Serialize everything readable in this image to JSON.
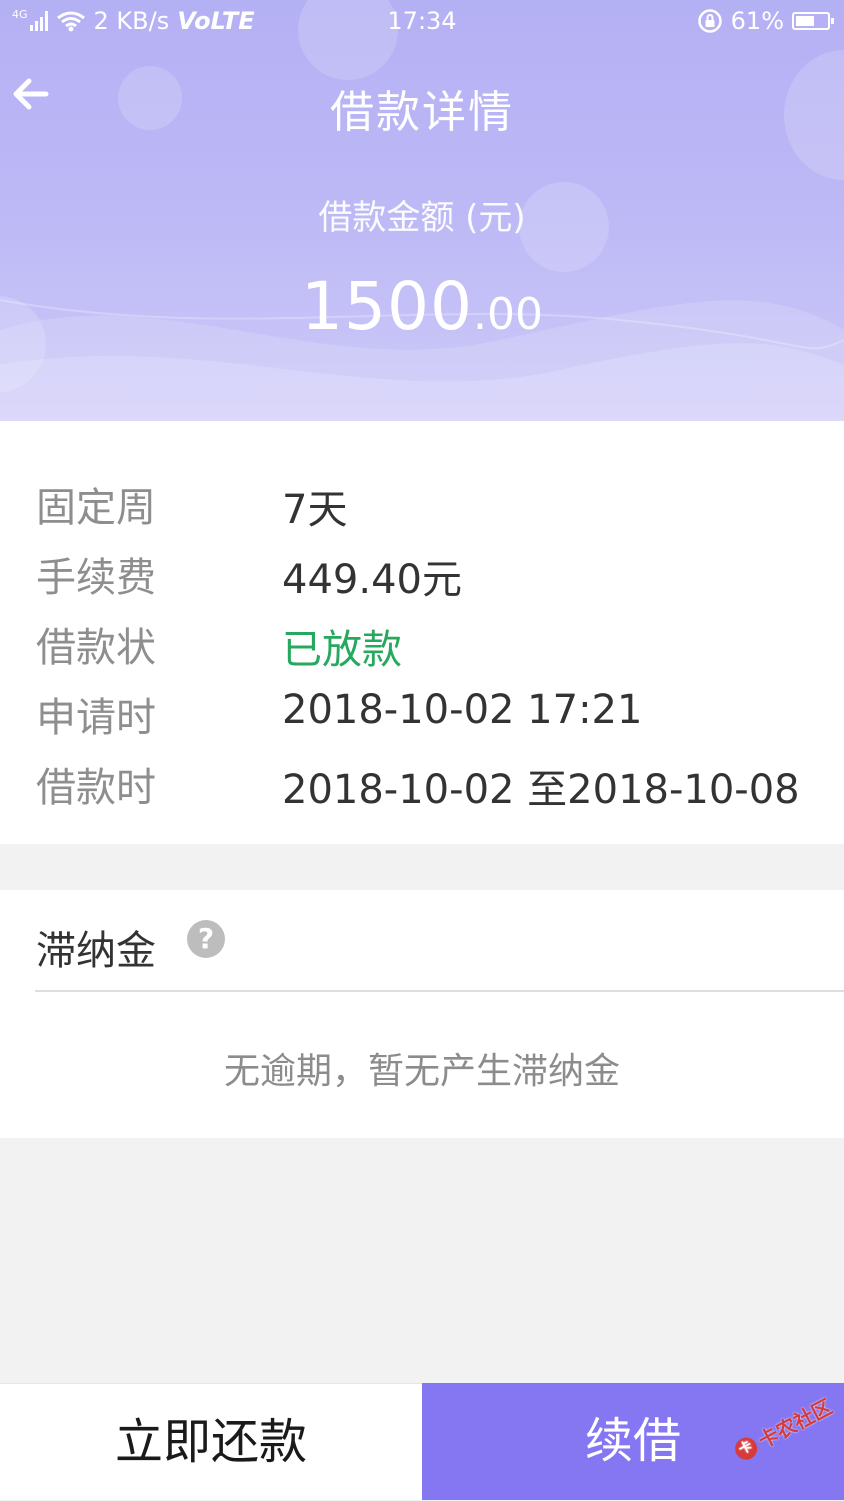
{
  "status_bar": {
    "network_small": "4G",
    "speed": "2 KB/s",
    "volte": "VoLTE",
    "time": "17:34",
    "battery": "61%",
    "battery_level": 0.61
  },
  "header": {
    "title": "借款详情",
    "amount_label": "借款金额 (元)",
    "amount_integer": "1500",
    "amount_decimal": ".00"
  },
  "details": [
    {
      "label": "固定周",
      "value": "7天"
    },
    {
      "label": "手续费",
      "value": "449.40元"
    },
    {
      "label": "借款状",
      "value": "已放款",
      "status_color": "#26a85e"
    },
    {
      "label": "申请时",
      "value": "2018-10-02 17:21"
    },
    {
      "label": "借款时",
      "value": "2018-10-02 至2018-10-08"
    }
  ],
  "late_fee": {
    "title": "滞纳金",
    "help_icon": "?",
    "empty_text": "无逾期，暂无产生滞纳金"
  },
  "actions": {
    "repay_label": "立即还款",
    "renew_label": "续借"
  },
  "watermark": {
    "text": "卡农社区",
    "mark": "卡"
  },
  "colors": {
    "header": "#b8b4f5",
    "accent": "#8576f2",
    "success": "#26a85e"
  }
}
